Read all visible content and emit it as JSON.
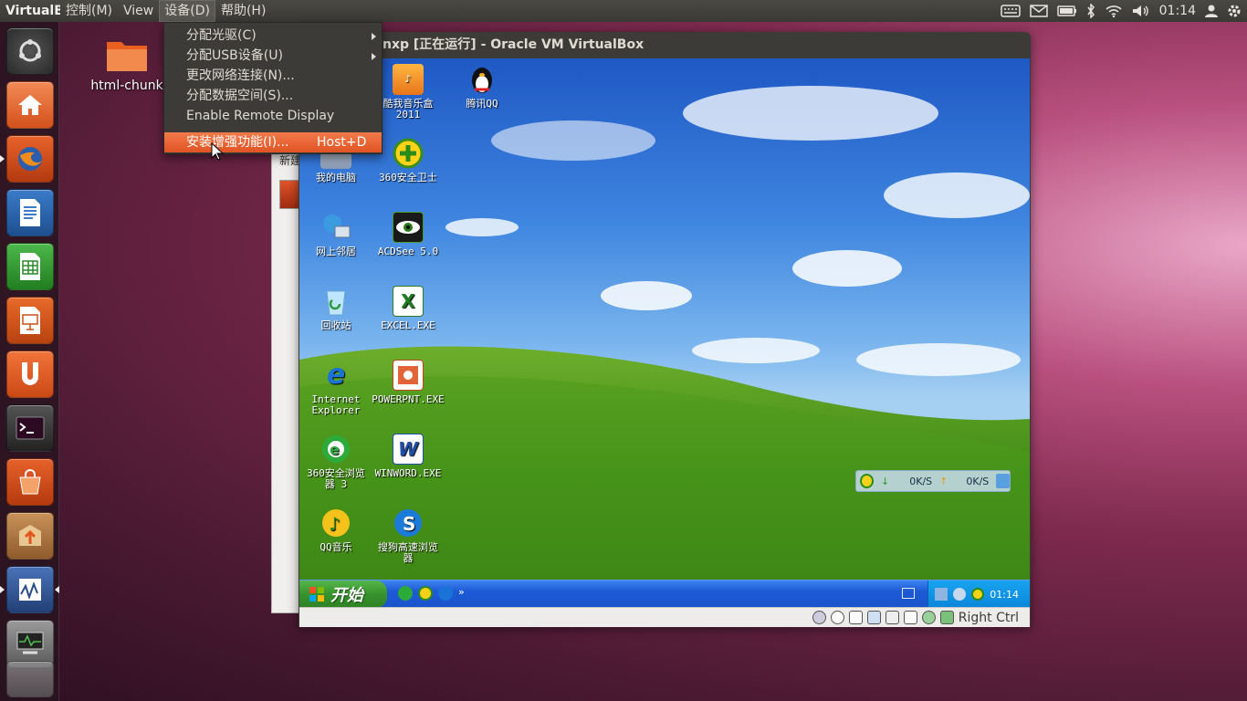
{
  "top_panel": {
    "app_title": "VirtualB",
    "menus": [
      "控制(M)",
      "View",
      "设备(D)",
      "帮助(H)"
    ],
    "active_menu": "设备(D)",
    "clock": "01:14",
    "indicator_icons": [
      "keyboard-icon",
      "mail-icon",
      "battery-icon",
      "bluetooth-icon",
      "wifi-icon",
      "volume-icon",
      "user-icon",
      "gear-icon"
    ]
  },
  "launcher": {
    "items": [
      "dash-home",
      "home-folder",
      "firefox",
      "libreoffice-writer",
      "libreoffice-calc",
      "libreoffice-impress",
      "ubuntu-one",
      "terminal",
      "software-center",
      "update-manager",
      "system-monitor",
      "system-monitor-2"
    ]
  },
  "desktop": {
    "folder_label": "html-chunk"
  },
  "device_menu": {
    "items": [
      {
        "label": "分配光驱(C)",
        "submenu": true
      },
      {
        "label": "分配USB设备(U)",
        "submenu": true
      },
      {
        "label": "更改网络连接(N)...",
        "submenu": false
      },
      {
        "label": "分配数据空间(S)...",
        "submenu": false
      },
      {
        "label": "Enable Remote Display",
        "submenu": false
      }
    ],
    "highlighted": {
      "label": "安装增强功能(I)...",
      "shortcut": "Host+D"
    }
  },
  "vm_window": {
    "title": "nxp [正在运行] - Oracle VM VirtualBox",
    "status_host_key": "Right Ctrl"
  },
  "guest": {
    "icons": [
      {
        "label": "酷我音乐盒\n2011"
      },
      {
        "label": "腾讯QQ"
      },
      {
        "label": "我的电脑"
      },
      {
        "label": "360安全卫士"
      },
      {
        "label": "网上邻居"
      },
      {
        "label": "ACDSee 5.0"
      },
      {
        "label": "回收站"
      },
      {
        "label": "EXCEL.EXE"
      },
      {
        "label": "Internet\nExplorer"
      },
      {
        "label": "POWERPNT.EXE"
      },
      {
        "label": "360安全浏览\n器 3"
      },
      {
        "label": "WINWORD.EXE"
      },
      {
        "label": "QQ音乐"
      },
      {
        "label": "搜狗高速浏览\n器"
      }
    ],
    "start_label": "开始",
    "tray_clock": "01:14",
    "net_down": "0K/S",
    "net_up": "0K/S",
    "behind_window_text": "新建"
  }
}
